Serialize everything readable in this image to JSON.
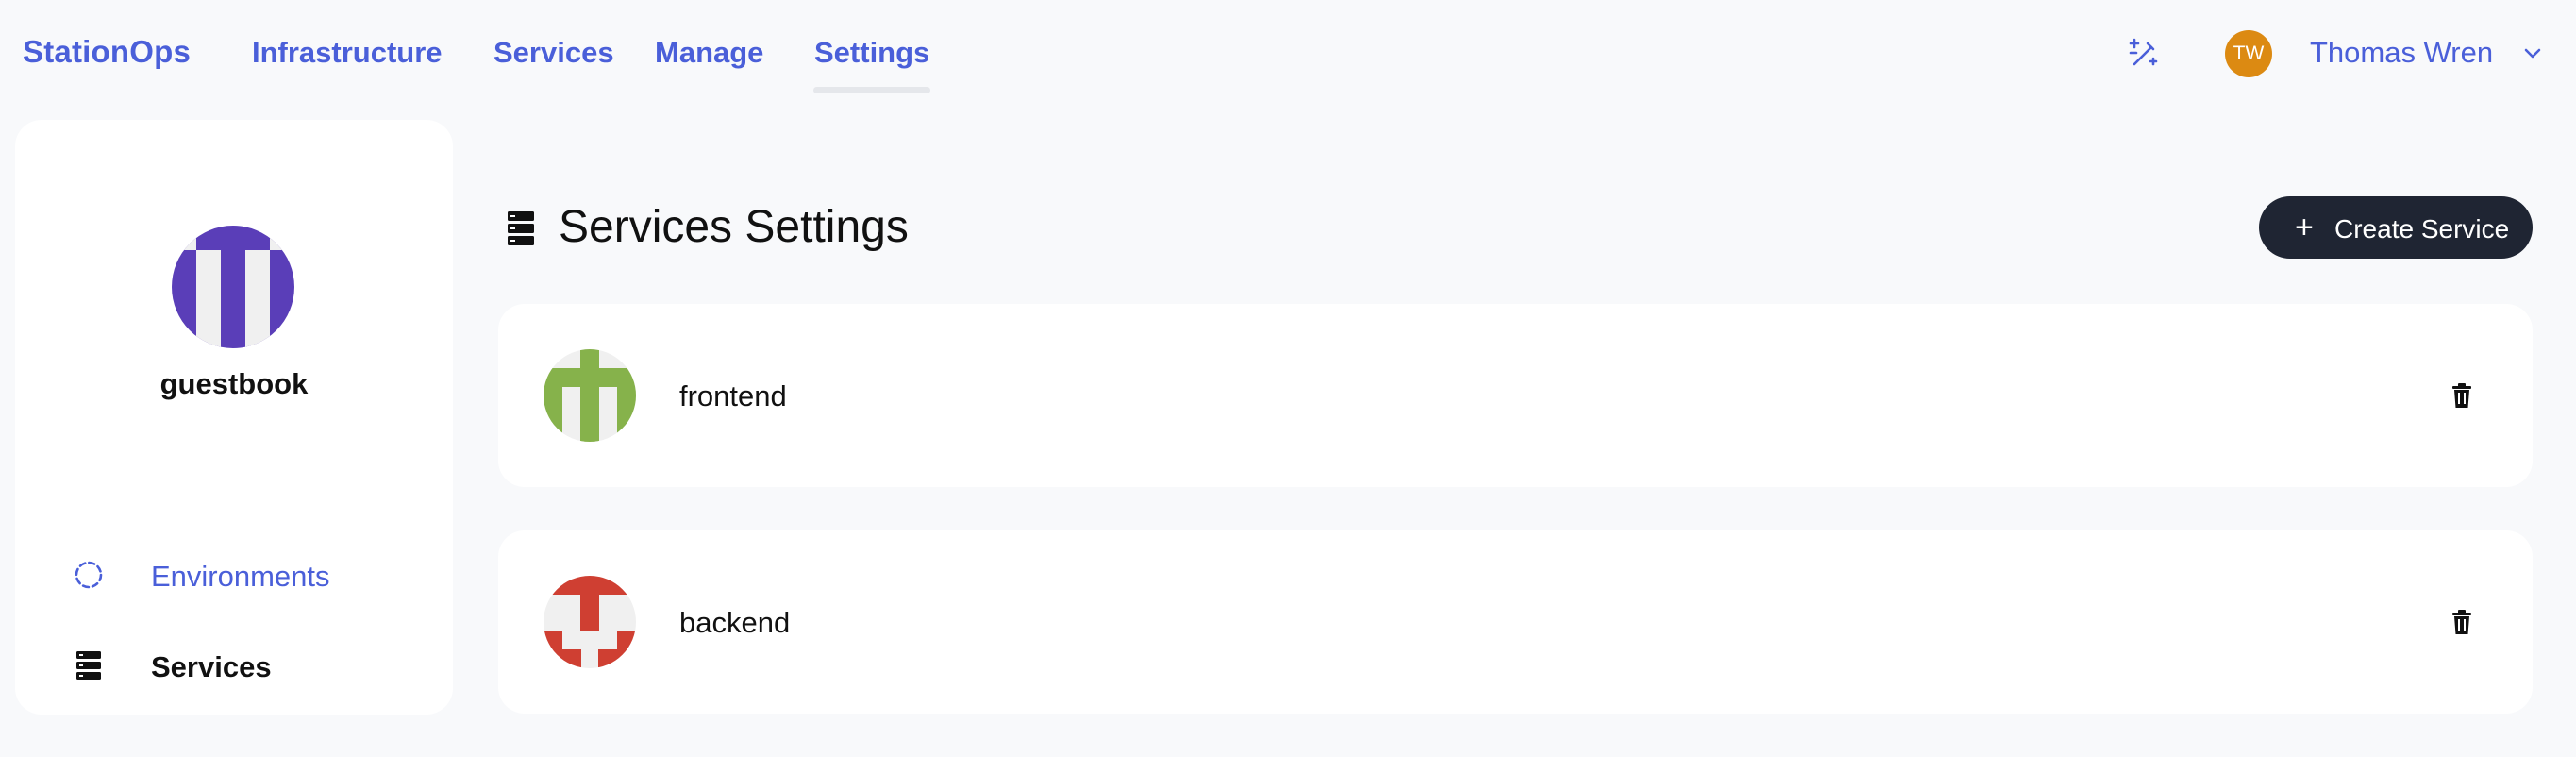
{
  "brand": "StationOps",
  "nav": {
    "items": [
      {
        "label": "Infrastructure"
      },
      {
        "label": "Services"
      },
      {
        "label": "Manage"
      },
      {
        "label": "Settings",
        "active": true
      }
    ]
  },
  "user": {
    "initials": "TW",
    "name": "Thomas Wren",
    "avatar_color": "#dc8a12"
  },
  "sidebar": {
    "project_name": "guestbook",
    "project_avatar_color": "#5a3eb8",
    "items": [
      {
        "label": "Environments",
        "icon": "circle-dashed-icon",
        "active": false
      },
      {
        "label": "Services",
        "icon": "server-stack-icon",
        "active": true
      }
    ]
  },
  "main": {
    "title": "Services Settings",
    "icon": "server-stack-icon",
    "create_button": {
      "plus": "+",
      "label": "Create Service"
    }
  },
  "services": [
    {
      "name": "frontend",
      "avatar_color": "#86b24b",
      "action_icon": "trash-icon"
    },
    {
      "name": "backend",
      "avatar_color": "#cf3f32",
      "action_icon": "trash-icon"
    }
  ],
  "colors": {
    "accent": "#4a5fd9",
    "background": "#f8f9fb",
    "button_dark": "#1f2533"
  }
}
